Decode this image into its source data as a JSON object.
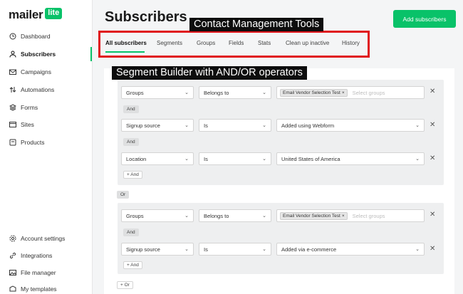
{
  "brand": {
    "name": "mailer",
    "badge": "lite"
  },
  "sidebar": {
    "items": [
      {
        "label": "Dashboard",
        "icon": "clock-icon"
      },
      {
        "label": "Subscribers",
        "icon": "user-icon"
      },
      {
        "label": "Campaigns",
        "icon": "mail-icon"
      },
      {
        "label": "Automations",
        "icon": "arrows-icon"
      },
      {
        "label": "Forms",
        "icon": "layers-icon"
      },
      {
        "label": "Sites",
        "icon": "browser-icon"
      },
      {
        "label": "Products",
        "icon": "box-icon"
      }
    ],
    "bottom_items": [
      {
        "label": "Account settings",
        "icon": "gear-icon"
      },
      {
        "label": "Integrations",
        "icon": "link-icon"
      },
      {
        "label": "File manager",
        "icon": "image-icon"
      },
      {
        "label": "My templates",
        "icon": "template-icon"
      }
    ]
  },
  "header": {
    "title": "Subscribers",
    "add_button": "Add subscribers"
  },
  "annotations": {
    "tabs_note": "Contact Management Tools",
    "builder_note": "Segment Builder with AND/OR operators"
  },
  "tabs": [
    "All subscribers",
    "Segments",
    "Groups",
    "Fields",
    "Stats",
    "Clean up inactive",
    "History"
  ],
  "builder": {
    "group1": {
      "row1": {
        "field": "Groups",
        "operator": "Belongs to",
        "chip": "Email Vendor Selection Test",
        "placeholder": "Select groups"
      },
      "and1": "And",
      "row2": {
        "field": "Signup source",
        "operator": "Is",
        "value": "Added using Webform"
      },
      "and2": "And",
      "row3": {
        "field": "Location",
        "operator": "Is",
        "value": "United States of America"
      },
      "add_and": "+ And"
    },
    "or": "Or",
    "group2": {
      "row1": {
        "field": "Groups",
        "operator": "Belongs to",
        "chip": "Email Vendor Selection Test",
        "placeholder": "Select groups"
      },
      "and1": "And",
      "row2": {
        "field": "Signup source",
        "operator": "Is",
        "value": "Added via e-commerce"
      },
      "add_and": "+ And"
    },
    "add_or": "+ Or"
  },
  "colors": {
    "accent": "#09c269",
    "highlight": "#e0151b",
    "annotation_bg": "#0d0d0d"
  }
}
